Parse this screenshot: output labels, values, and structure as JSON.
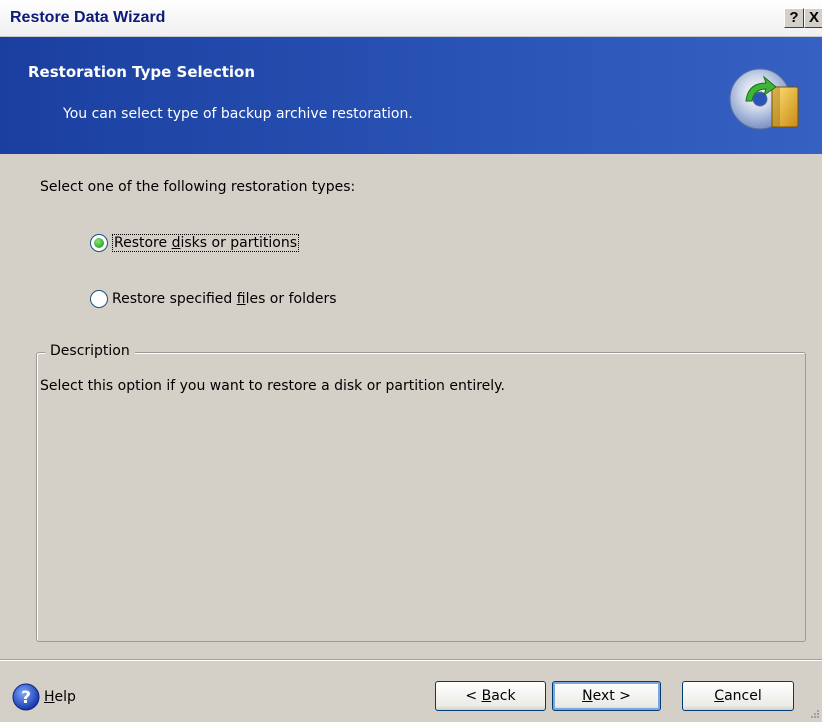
{
  "window": {
    "title": "Restore Data Wizard",
    "help_button": "?",
    "close_button": "X"
  },
  "header": {
    "title": "Restoration Type Selection",
    "subtitle": "You can select type of backup archive restoration.",
    "icon": "backup-disk-icon"
  },
  "main": {
    "prompt": "Select one of the following restoration types:",
    "options": [
      {
        "pre": "Restore ",
        "hotkey": "d",
        "post": "isks or partitions",
        "selected": true
      },
      {
        "pre": "Restore specified ",
        "hotkey": "f",
        "post": "iles or folders",
        "selected": false
      }
    ],
    "description": {
      "legend": "Description",
      "text": "Select this option if you want to restore a disk or partition entirely."
    }
  },
  "footer": {
    "help": {
      "hotkey": "H",
      "rest": "elp",
      "icon": "help-question-icon"
    },
    "back": {
      "pre": "< ",
      "hotkey": "B",
      "post": "ack"
    },
    "next": {
      "pre": "",
      "hotkey": "N",
      "post": "ext >"
    },
    "cancel": {
      "pre": "",
      "hotkey": "C",
      "post": "ancel"
    }
  },
  "colors": {
    "title_text": "#0c1a7a",
    "header_bg": "#2a54b6",
    "dialog_bg": "#d4d0c8",
    "radio_selected": "#2fae2a"
  }
}
